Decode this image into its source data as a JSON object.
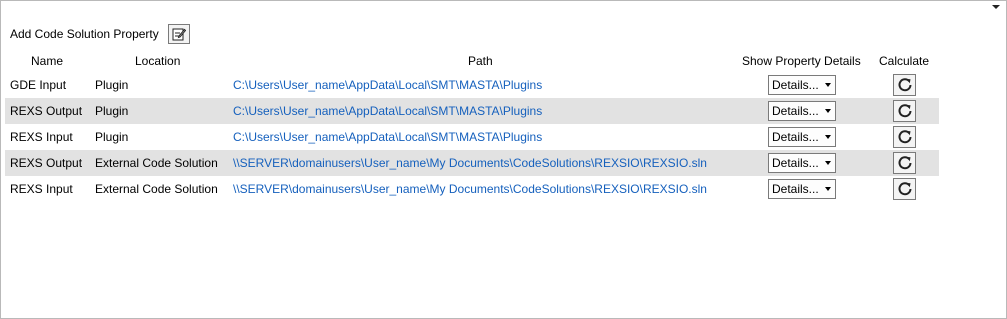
{
  "toolbar": {
    "add_label": "Add Code Solution Property",
    "add_icon": "edit-icon"
  },
  "table": {
    "headers": {
      "name": "Name",
      "location": "Location",
      "path": "Path",
      "show_details": "Show Property Details",
      "calculate": "Calculate"
    },
    "rows": [
      {
        "name": "GDE Input",
        "location": "Plugin",
        "path": "C:\\Users\\User_name\\AppData\\Local\\SMT\\MASTA\\Plugins",
        "details": "Details...",
        "shaded": false
      },
      {
        "name": "REXS Output",
        "location": "Plugin",
        "path": "C:\\Users\\User_name\\AppData\\Local\\SMT\\MASTA\\Plugins",
        "details": "Details...",
        "shaded": true
      },
      {
        "name": "REXS Input",
        "location": "Plugin",
        "path": "C:\\Users\\User_name\\AppData\\Local\\SMT\\MASTA\\Plugins",
        "details": "Details...",
        "shaded": false
      },
      {
        "name": "REXS Output",
        "location": "External Code Solution",
        "path": "\\\\SERVER\\domainusers\\User_name\\My Documents\\CodeSolutions\\REXSIO\\REXSIO.sln",
        "details": "Details...",
        "shaded": true
      },
      {
        "name": "REXS Input",
        "location": "External Code Solution",
        "path": "\\\\SERVER\\domainusers\\User_name\\My Documents\\CodeSolutions\\REXSIO\\REXSIO.sln",
        "details": "Details...",
        "shaded": false
      }
    ]
  },
  "colors": {
    "link": "#1560bd",
    "row_shade": "#e2e2e2"
  }
}
